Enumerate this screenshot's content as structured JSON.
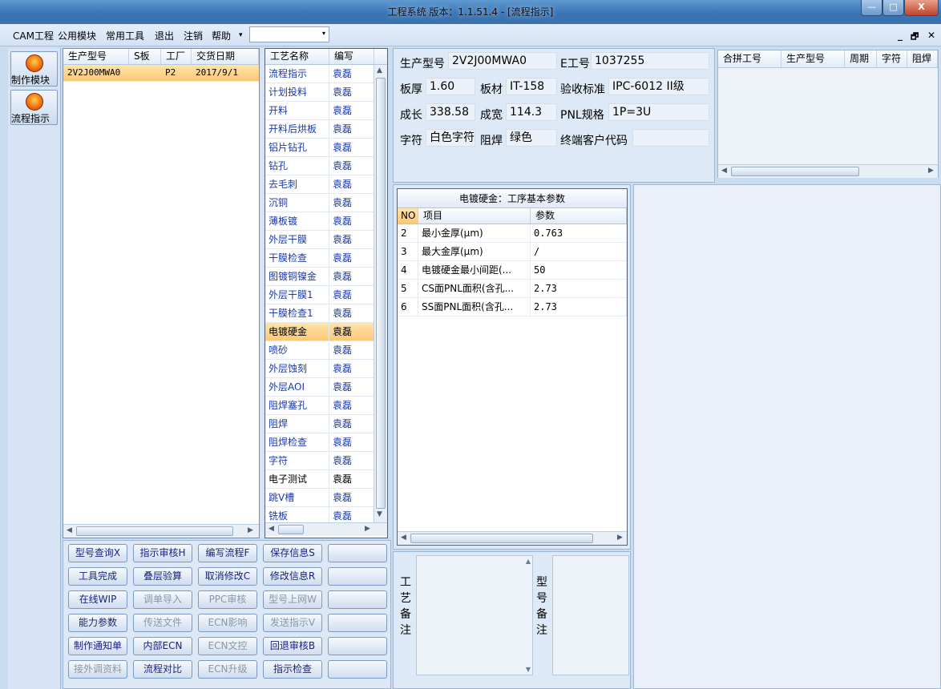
{
  "window": {
    "title": "工程系统   版本：1.1.51.4 - [流程指示]",
    "min_btn": "—",
    "max_btn": "□",
    "close_btn": "X"
  },
  "menu": {
    "items": [
      "CAM工程",
      "公用模块",
      "常用工具",
      "退出",
      "注销",
      "帮助"
    ],
    "overflow": "▾",
    "combo_value": "",
    "combo_arrow": "▾",
    "mdi_min": "_",
    "mdi_restore": "🗗",
    "mdi_close": "✕"
  },
  "tool_strip": [
    {
      "label": "制作模块",
      "icon": "fire-icon"
    },
    {
      "label": "流程指示",
      "icon": "flow-icon"
    }
  ],
  "model_grid": {
    "columns": [
      "生产型号",
      "S板",
      "工厂",
      "交货日期"
    ],
    "rows": [
      {
        "model": "2V2J00MWA0",
        "s": "",
        "factory": "P2",
        "date": "2017/9/1"
      }
    ]
  },
  "process_list": {
    "columns": [
      "工艺名称",
      "编写"
    ],
    "rows": [
      {
        "name": "流程指示",
        "author": "袁磊"
      },
      {
        "name": "计划投料",
        "author": "袁磊"
      },
      {
        "name": "开料",
        "author": "袁磊"
      },
      {
        "name": "开料后烘板",
        "author": "袁磊"
      },
      {
        "name": "铝片钻孔",
        "author": "袁磊"
      },
      {
        "name": "钻孔",
        "author": "袁磊"
      },
      {
        "name": "去毛刺",
        "author": "袁磊"
      },
      {
        "name": "沉铜",
        "author": "袁磊"
      },
      {
        "name": "薄板镀",
        "author": "袁磊"
      },
      {
        "name": "外层干膜",
        "author": "袁磊"
      },
      {
        "name": "干膜检查",
        "author": "袁磊"
      },
      {
        "name": "图镀铜镍金",
        "author": "袁磊"
      },
      {
        "name": "外层干膜1",
        "author": "袁磊"
      },
      {
        "name": "干膜检查1",
        "author": "袁磊"
      },
      {
        "name": "电镀硬金",
        "author": "袁磊"
      },
      {
        "name": "喷砂",
        "author": "袁磊"
      },
      {
        "name": "外层蚀刻",
        "author": "袁磊"
      },
      {
        "name": "外层AOI",
        "author": "袁磊"
      },
      {
        "name": "阻焊塞孔",
        "author": "袁磊"
      },
      {
        "name": "阻焊",
        "author": "袁磊"
      },
      {
        "name": "阻焊检查",
        "author": "袁磊"
      },
      {
        "name": "字符",
        "author": "袁磊"
      },
      {
        "name": "电子测试",
        "author": "袁磊"
      },
      {
        "name": "跳V槽",
        "author": "袁磊"
      },
      {
        "name": "铣板",
        "author": "袁磊"
      }
    ],
    "selected_name": "电镀硬金"
  },
  "info": {
    "model_label": "生产型号",
    "model_value": "2V2J00MWA0",
    "ejob_label": "E工号",
    "ejob_value": "1037255",
    "thick_label": "板厚",
    "thick_value": "1.60",
    "material_label": "板材",
    "material_value": "IT-158",
    "accept_label": "验收标准",
    "accept_value": "IPC-6012 II级",
    "len_label": "成长",
    "len_value": "338.58",
    "width_label": "成宽",
    "width_value": "114.3",
    "pnl_label": "PNL规格",
    "pnl_value": "1P=3U",
    "char_label": "字符",
    "char_value": "白色字符",
    "mask_label": "阻焊",
    "mask_value": "绿色",
    "endcust_label": "终端客户代码",
    "endcust_value": ""
  },
  "combine_grid": {
    "columns": [
      "合拼工号",
      "生产型号",
      "周期",
      "字符",
      "阻焊"
    ]
  },
  "params": {
    "title": "电镀硬金：工序基本参数",
    "columns": [
      "NO",
      "项目",
      "参数"
    ],
    "rows": [
      {
        "no": "2",
        "item": "最小金厚(μm)",
        "value": "0.763"
      },
      {
        "no": "3",
        "item": "最大金厚(μm)",
        "value": "/"
      },
      {
        "no": "4",
        "item": "电镀硬金最小间距(...",
        "value": "50"
      },
      {
        "no": "5",
        "item": "CS面PNL面积(含孔...",
        "value": "2.73"
      },
      {
        "no": "6",
        "item": "SS面PNL面积(含孔...",
        "value": "2.73"
      }
    ]
  },
  "notes": {
    "process_label": "工艺备注",
    "model_label": "型号备注"
  },
  "actions": [
    {
      "label": "型号查询X",
      "enabled": true
    },
    {
      "label": "指示审核H",
      "enabled": true
    },
    {
      "label": "编写流程F",
      "enabled": true
    },
    {
      "label": "保存信息S",
      "enabled": true
    },
    {
      "label": "",
      "enabled": true
    },
    {
      "label": "工具完成",
      "enabled": true
    },
    {
      "label": "叠层验算",
      "enabled": true
    },
    {
      "label": "取消修改C",
      "enabled": true
    },
    {
      "label": "修改信息R",
      "enabled": true
    },
    {
      "label": "",
      "enabled": true
    },
    {
      "label": "在线WIP",
      "enabled": true
    },
    {
      "label": "调单导入",
      "enabled": false
    },
    {
      "label": "PPC审核",
      "enabled": false
    },
    {
      "label": "型号上网W",
      "enabled": false
    },
    {
      "label": "",
      "enabled": true
    },
    {
      "label": "能力参数",
      "enabled": true
    },
    {
      "label": "传送文件",
      "enabled": false
    },
    {
      "label": "ECN影响",
      "enabled": false
    },
    {
      "label": "发送指示V",
      "enabled": false
    },
    {
      "label": "",
      "enabled": true
    },
    {
      "label": "制作通知单",
      "enabled": true
    },
    {
      "label": "内部ECN",
      "enabled": true
    },
    {
      "label": "ECN文控",
      "enabled": false
    },
    {
      "label": "回退审核B",
      "enabled": true
    },
    {
      "label": "",
      "enabled": true
    },
    {
      "label": "接外调资料",
      "enabled": false
    },
    {
      "label": "流程对比",
      "enabled": true
    },
    {
      "label": "ECN升级",
      "enabled": false
    },
    {
      "label": "指示检查",
      "enabled": true
    },
    {
      "label": "",
      "enabled": true
    }
  ]
}
